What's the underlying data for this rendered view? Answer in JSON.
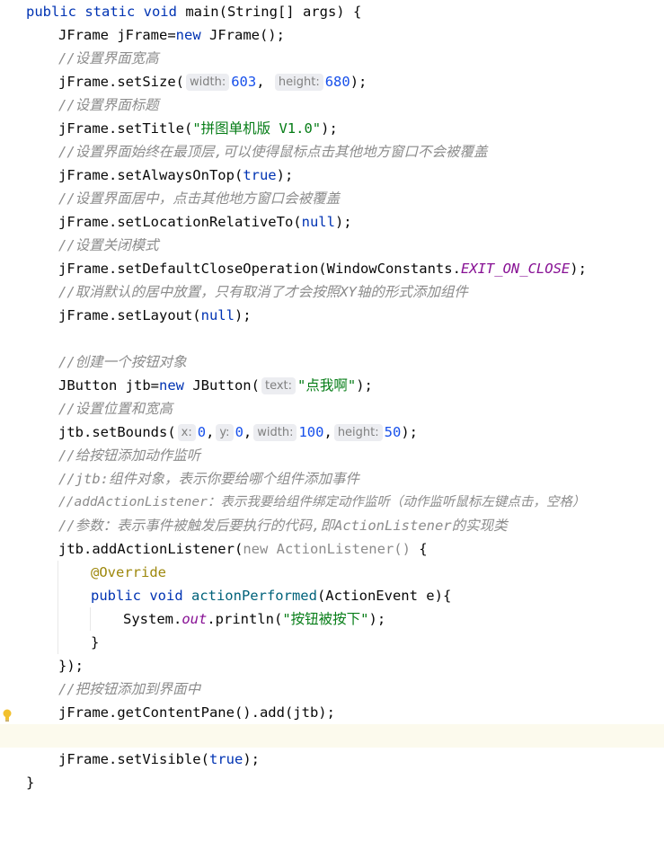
{
  "code": {
    "l1": {
      "kw": "public static void ",
      "rest": "main(String[] args) {"
    },
    "l2": {
      "a": "JFrame jFrame=",
      "kw": "new",
      "b": " JFrame();"
    },
    "l3": {
      "comment": "//设置界面宽高"
    },
    "l4": {
      "a": "jFrame.setSize(",
      "hint1": "width:",
      "v1": "603",
      "sep": ", ",
      "hint2": "height:",
      "v2": "680",
      "b": ");"
    },
    "l5": {
      "comment": "//设置界面标题"
    },
    "l6": {
      "a": "jFrame.setTitle(",
      "str": "\"拼图单机版 V1.0\"",
      "b": ");"
    },
    "l7": {
      "comment": "//设置界面始终在最顶层,可以使得鼠标点击其他地方窗口不会被覆盖"
    },
    "l8": {
      "a": "jFrame.setAlwaysOnTop(",
      "kw": "true",
      "b": ");"
    },
    "l9": {
      "comment": "//设置界面居中，点击其他地方窗口会被覆盖"
    },
    "l10": {
      "a": "jFrame.setLocationRelativeTo(",
      "kw": "null",
      "b": ");"
    },
    "l11": {
      "comment": "//设置关闭模式"
    },
    "l12": {
      "a": "jFrame.setDefaultCloseOperation(WindowConstants.",
      "stat": "EXIT_ON_CLOSE",
      "b": ");"
    },
    "l13": {
      "comment": "//取消默认的居中放置，只有取消了才会按照XY轴的形式添加组件"
    },
    "l14": {
      "a": "jFrame.setLayout(",
      "kw": "null",
      "b": ");"
    },
    "l16": {
      "comment": "//创建一个按钮对象"
    },
    "l17": {
      "a": "JButton jtb=",
      "kw": "new",
      "b": " JButton(",
      "hint": "text:",
      "str": "\"点我啊\"",
      "c": ");"
    },
    "l18": {
      "comment": "//设置位置和宽高"
    },
    "l19": {
      "a": "jtb.setBounds(",
      "h1": "x:",
      "v1": "0",
      "s1": ",",
      "h2": "y:",
      "v2": "0",
      "s2": ",",
      "h3": "width:",
      "v3": "100",
      "s3": ",",
      "h4": "height:",
      "v4": "50",
      "b": ");"
    },
    "l20": {
      "comment": "//给按钮添加动作监听"
    },
    "l21": {
      "comment": "//jtb:组件对象，表示你要给哪个组件添加事件"
    },
    "l22": {
      "comment": "//addActionListener：表示我要给组件绑定动作监听（动作监听鼠标左键点击，空格）"
    },
    "l23": {
      "comment": "//参数：表示事件被触发后要执行的代码,即ActionListener的实现类"
    },
    "l24": {
      "a": "jtb.addActionListener(",
      "gray": "new ActionListener()",
      "b": " {"
    },
    "l25": {
      "ann": "@Override"
    },
    "l26": {
      "kw": "public void ",
      "meth": "actionPerformed",
      "b": "(ActionEvent e){"
    },
    "l27": {
      "a": "System.",
      "stat": "out",
      "b": ".println(",
      "str": "\"按钮被按下\"",
      "c": ");"
    },
    "l28": {
      "a": "}"
    },
    "l29": {
      "a": "});"
    },
    "l30": {
      "comment": "//把按钮添加到界面中"
    },
    "l31": {
      "a": "jFrame.getContentPane().add(jtb);"
    },
    "l33": {
      "a": "jFrame.setVisible(",
      "kw": "true",
      "b": ");"
    },
    "l34": {
      "a": "}"
    }
  },
  "colors": {
    "keyword": "#0033b3",
    "string": "#067d17",
    "number": "#1750eb",
    "comment": "#8c8c8c",
    "annotation": "#9e880d",
    "static_field": "#871094",
    "method_decl": "#00627a",
    "current_line": "#fcfaed",
    "bulb": "#f2c12e"
  },
  "icons": {
    "gutter": "lightbulb-icon"
  }
}
